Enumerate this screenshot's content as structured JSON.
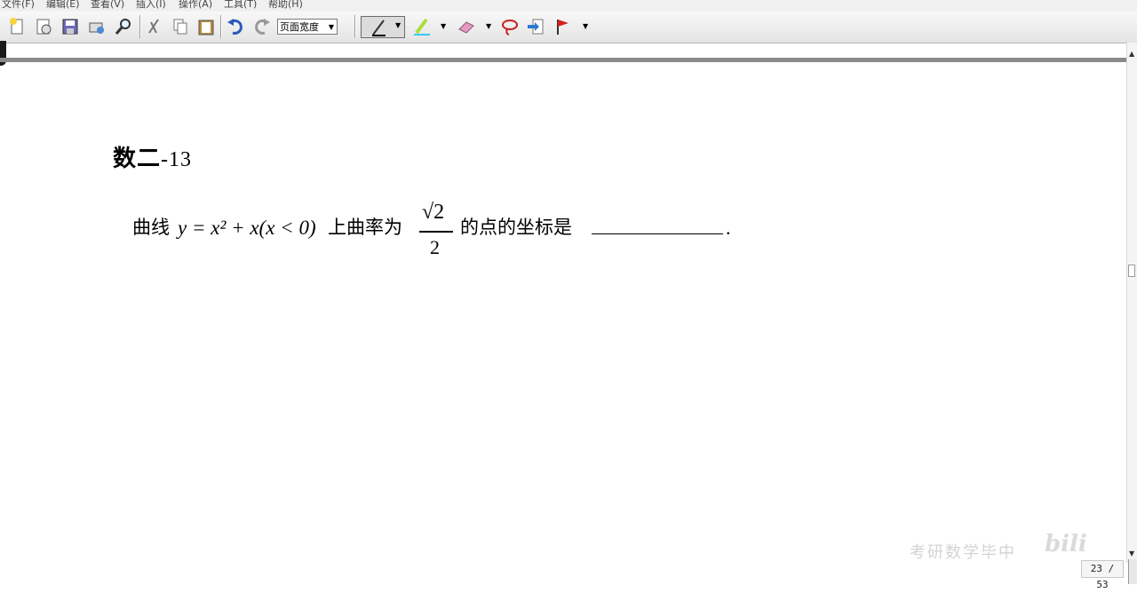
{
  "menu": {
    "items": [
      "文件(F)",
      "编辑(E)",
      "查看(V)",
      "插入(I)",
      "操作(A)",
      "工具(T)",
      "帮助(H)"
    ]
  },
  "toolbar": {
    "zoom_value": "页面宽度",
    "icons": [
      "new-icon",
      "open-icon",
      "save-icon",
      "print-icon",
      "find-icon",
      "cut-icon",
      "copy-icon",
      "paste-icon",
      "undo-icon",
      "redo-icon",
      "pen-icon",
      "highlighter-icon",
      "eraser-icon",
      "lasso-icon",
      "insert-space-icon",
      "flag-icon"
    ]
  },
  "document": {
    "heading_cn": "数二",
    "heading_num": "-13",
    "problem": {
      "prefix": "曲线",
      "equation": "y = x² + x(x < 0)",
      "middle": "上曲率为",
      "fraction_numerator": "√2",
      "fraction_denominator": "2",
      "suffix": "的点的坐标是",
      "end": "."
    }
  },
  "watermark": {
    "text": "考研数学毕中",
    "logo": "bili"
  },
  "page_counter": "23 / 53",
  "colors": {
    "menubar_bg": "#f0f0f0",
    "toolbar_bg": "#e8e8e8",
    "page_band": "#8a8a8a",
    "text": "#000000"
  }
}
